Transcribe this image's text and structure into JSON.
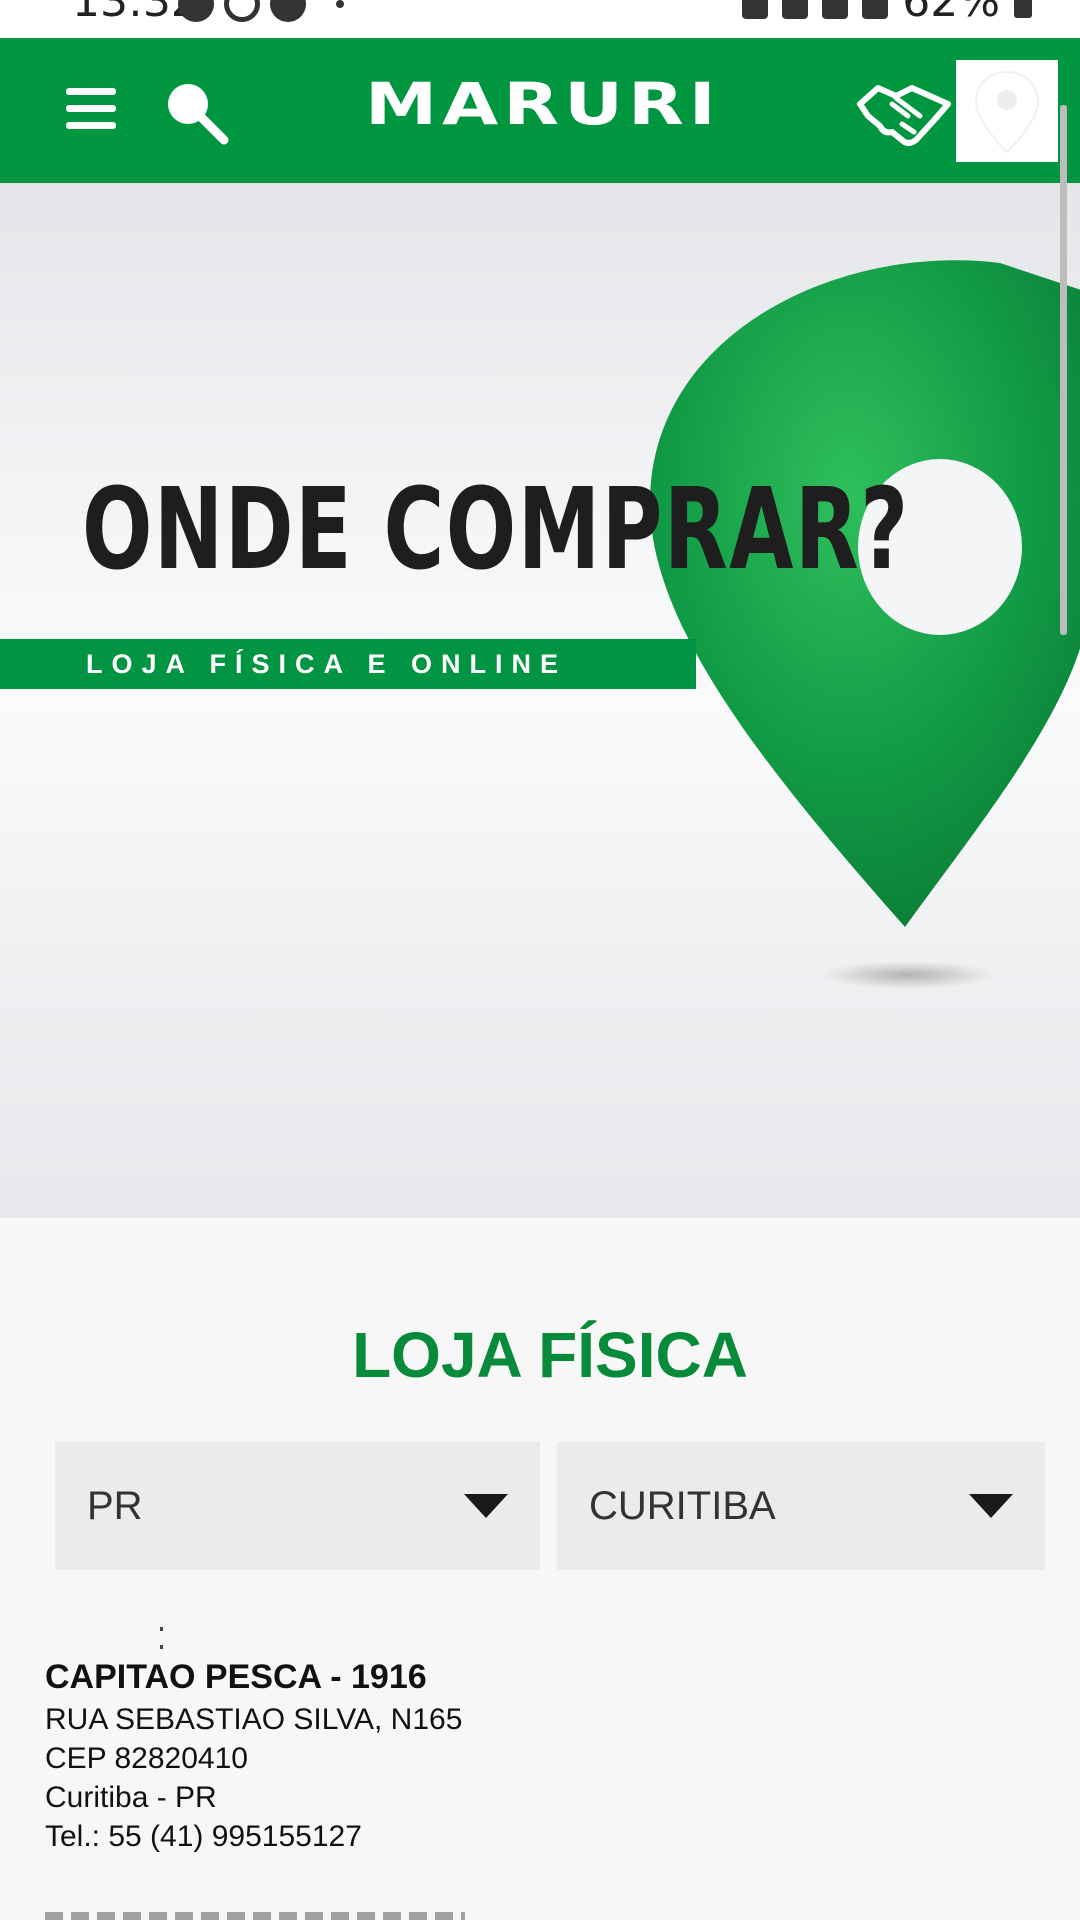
{
  "status_bar": {
    "time": "13:32",
    "battery": "62%"
  },
  "header": {
    "logo": "MARURI",
    "icons": [
      "menu-icon",
      "search-icon",
      "handshake-icon",
      "location-pin-icon"
    ]
  },
  "hero": {
    "title": "ONDE COMPRAR?",
    "subtitle": "LOJA FÍSICA E ONLINE"
  },
  "stores_section": {
    "title": "LOJA FÍSICA",
    "state_select": {
      "value": "PR"
    },
    "city_select": {
      "value": "CURITIBA"
    }
  },
  "store": {
    "name": "CAPITAO PESCA - 1916",
    "address": "RUA SEBASTIAO SILVA, N165",
    "cep": "CEP 82820410",
    "city": "Curitiba - PR",
    "phone": "Tel.: 55 (41) 995155127"
  },
  "colors": {
    "brand_green": "#009640",
    "title_green": "#088a3b"
  }
}
